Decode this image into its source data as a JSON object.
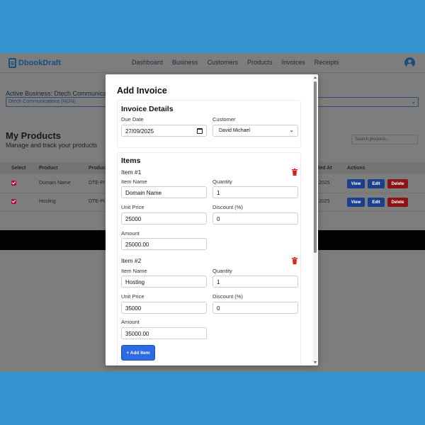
{
  "app": {
    "logo_text": "DbookDraft",
    "nav": [
      "Dashboard",
      "Business",
      "Customers",
      "Products",
      "Invoices",
      "Receipts"
    ]
  },
  "business": {
    "active_label": "Active Business: Dtech Communica",
    "selected": "Dtech Communications (NGN)"
  },
  "products_page": {
    "title": "My Products",
    "subtitle": "Manage and track your products",
    "search_placeholder": "Search products...",
    "columns": [
      "Select",
      "Product",
      "Produc",
      "ted At",
      "Actions"
    ],
    "rows": [
      {
        "product": "Domain Name",
        "code": "DTE-PI",
        "date": "2025"
      },
      {
        "product": "Hosting",
        "code": "DTE-PI",
        "date": "2025"
      }
    ],
    "actions": {
      "view": "View",
      "edit": "Edit",
      "delete": "Delete"
    }
  },
  "modal": {
    "title": "Add Invoice",
    "details": {
      "heading": "Invoice Details",
      "due_date_label": "Due Date",
      "due_date": "27/09/2025",
      "customer_label": "Customer",
      "customer": "David Michael"
    },
    "items_heading": "Items",
    "items": [
      {
        "title": "Item #1",
        "name_label": "Item Name",
        "name": "Domain Name",
        "qty_label": "Quantity",
        "qty": "1",
        "price_label": "Unit Price",
        "price": "25000",
        "discount_label": "Discount (%)",
        "discount": "0",
        "amount_label": "Amount",
        "amount": "25000.00"
      },
      {
        "title": "Item #2",
        "name_label": "Item Name",
        "name": "Hosting",
        "qty_label": "Quantity",
        "qty": "1",
        "price_label": "Unit Price",
        "price": "35000",
        "discount_label": "Discount (%)",
        "discount": "0",
        "amount_label": "Amount",
        "amount": "35000.00"
      }
    ],
    "add_item": "+ Add Item"
  },
  "colors": {
    "accent": "#2d6be4",
    "danger": "#e0201f",
    "brand": "#174f80",
    "background": "#3593d2"
  }
}
